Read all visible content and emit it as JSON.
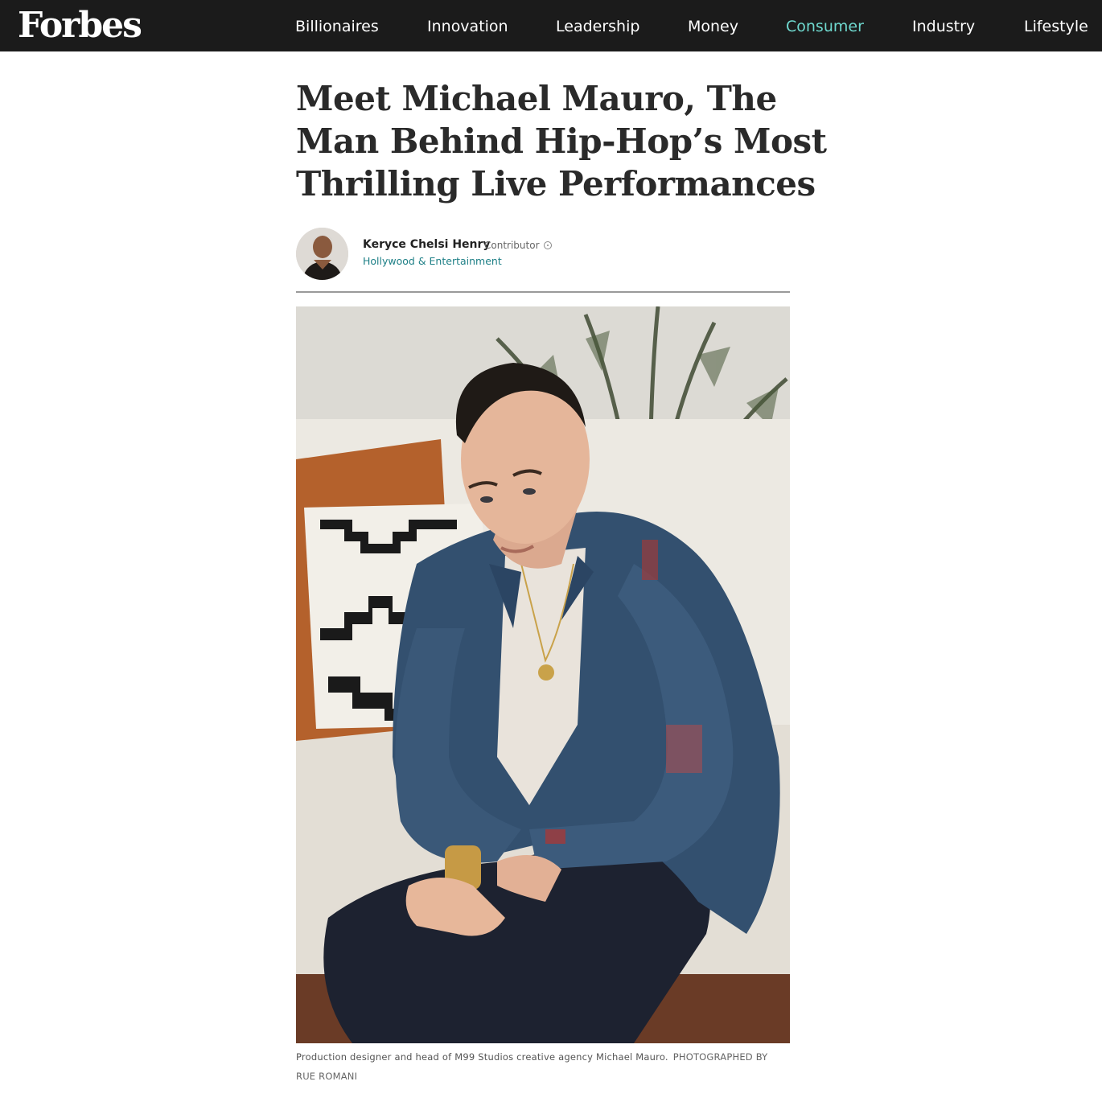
{
  "header": {
    "logo": "Forbes",
    "nav": [
      {
        "label": "Billionaires"
      },
      {
        "label": "Innovation"
      },
      {
        "label": "Leadership"
      },
      {
        "label": "Money"
      },
      {
        "label": "Consumer",
        "active": true
      },
      {
        "label": "Industry"
      },
      {
        "label": "Lifestyle"
      }
    ],
    "colors": {
      "bar": "#1b1b1b",
      "active": "#6fd9cf"
    }
  },
  "article": {
    "headline": "Meet Michael Mauro, The Man Behind Hip-Hop’s Most Thrilling Live Performances",
    "author": {
      "name": "Keryce Chelsi Henry",
      "role": "Contributor",
      "channel": "Hollywood & Entertainment",
      "avatar_icon": "author-avatar-photo"
    },
    "hero_image": {
      "subject": "man-in-denim-jacket-photo"
    },
    "caption": {
      "text": "Production designer and head of M99 Studios creative agency Michael Mauro.",
      "credit": "PHOTOGRAPHED BY RUE ROMANI"
    }
  }
}
